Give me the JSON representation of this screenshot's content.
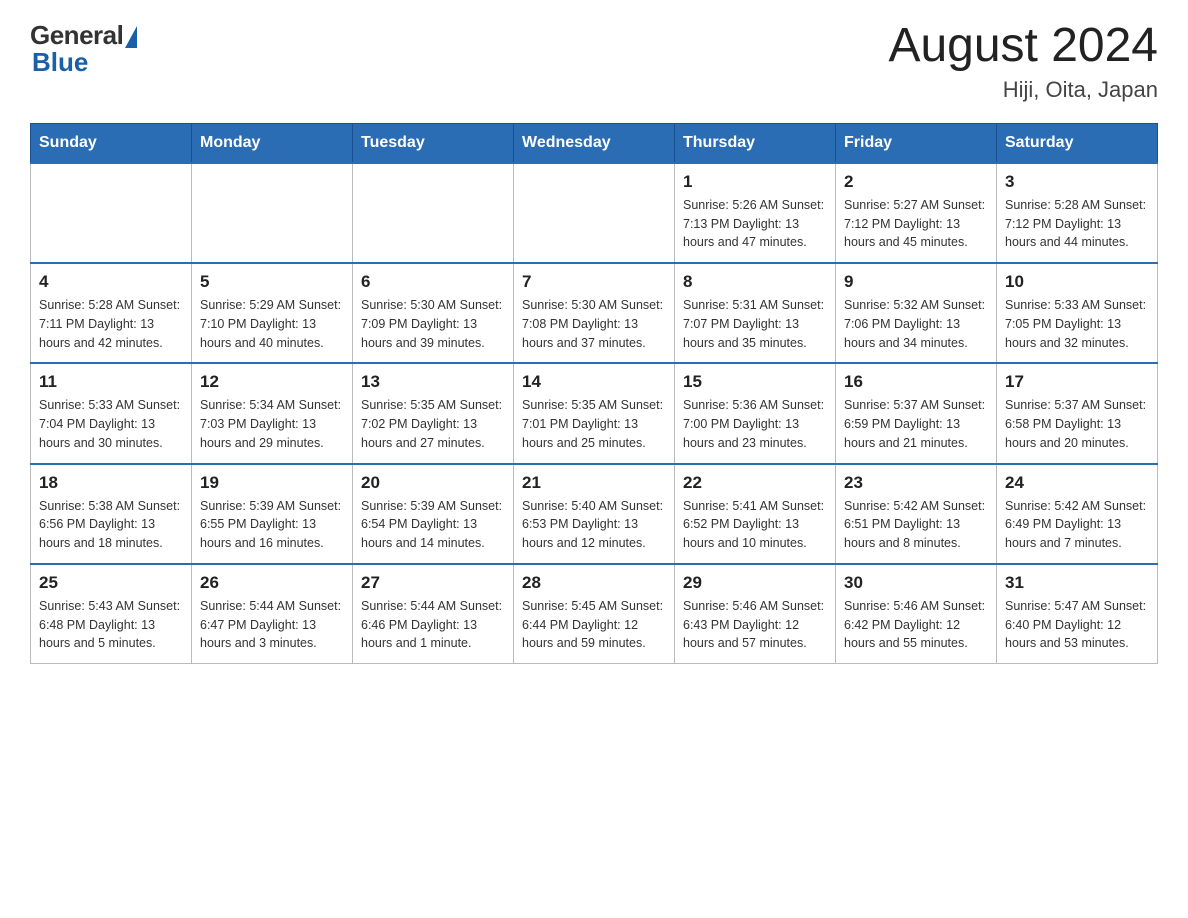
{
  "header": {
    "logo": {
      "general_text": "General",
      "blue_text": "Blue"
    },
    "title": "August 2024",
    "location": "Hiji, Oita, Japan"
  },
  "calendar": {
    "days_of_week": [
      "Sunday",
      "Monday",
      "Tuesday",
      "Wednesday",
      "Thursday",
      "Friday",
      "Saturday"
    ],
    "weeks": [
      [
        {
          "day": "",
          "info": ""
        },
        {
          "day": "",
          "info": ""
        },
        {
          "day": "",
          "info": ""
        },
        {
          "day": "",
          "info": ""
        },
        {
          "day": "1",
          "info": "Sunrise: 5:26 AM\nSunset: 7:13 PM\nDaylight: 13 hours\nand 47 minutes."
        },
        {
          "day": "2",
          "info": "Sunrise: 5:27 AM\nSunset: 7:12 PM\nDaylight: 13 hours\nand 45 minutes."
        },
        {
          "day": "3",
          "info": "Sunrise: 5:28 AM\nSunset: 7:12 PM\nDaylight: 13 hours\nand 44 minutes."
        }
      ],
      [
        {
          "day": "4",
          "info": "Sunrise: 5:28 AM\nSunset: 7:11 PM\nDaylight: 13 hours\nand 42 minutes."
        },
        {
          "day": "5",
          "info": "Sunrise: 5:29 AM\nSunset: 7:10 PM\nDaylight: 13 hours\nand 40 minutes."
        },
        {
          "day": "6",
          "info": "Sunrise: 5:30 AM\nSunset: 7:09 PM\nDaylight: 13 hours\nand 39 minutes."
        },
        {
          "day": "7",
          "info": "Sunrise: 5:30 AM\nSunset: 7:08 PM\nDaylight: 13 hours\nand 37 minutes."
        },
        {
          "day": "8",
          "info": "Sunrise: 5:31 AM\nSunset: 7:07 PM\nDaylight: 13 hours\nand 35 minutes."
        },
        {
          "day": "9",
          "info": "Sunrise: 5:32 AM\nSunset: 7:06 PM\nDaylight: 13 hours\nand 34 minutes."
        },
        {
          "day": "10",
          "info": "Sunrise: 5:33 AM\nSunset: 7:05 PM\nDaylight: 13 hours\nand 32 minutes."
        }
      ],
      [
        {
          "day": "11",
          "info": "Sunrise: 5:33 AM\nSunset: 7:04 PM\nDaylight: 13 hours\nand 30 minutes."
        },
        {
          "day": "12",
          "info": "Sunrise: 5:34 AM\nSunset: 7:03 PM\nDaylight: 13 hours\nand 29 minutes."
        },
        {
          "day": "13",
          "info": "Sunrise: 5:35 AM\nSunset: 7:02 PM\nDaylight: 13 hours\nand 27 minutes."
        },
        {
          "day": "14",
          "info": "Sunrise: 5:35 AM\nSunset: 7:01 PM\nDaylight: 13 hours\nand 25 minutes."
        },
        {
          "day": "15",
          "info": "Sunrise: 5:36 AM\nSunset: 7:00 PM\nDaylight: 13 hours\nand 23 minutes."
        },
        {
          "day": "16",
          "info": "Sunrise: 5:37 AM\nSunset: 6:59 PM\nDaylight: 13 hours\nand 21 minutes."
        },
        {
          "day": "17",
          "info": "Sunrise: 5:37 AM\nSunset: 6:58 PM\nDaylight: 13 hours\nand 20 minutes."
        }
      ],
      [
        {
          "day": "18",
          "info": "Sunrise: 5:38 AM\nSunset: 6:56 PM\nDaylight: 13 hours\nand 18 minutes."
        },
        {
          "day": "19",
          "info": "Sunrise: 5:39 AM\nSunset: 6:55 PM\nDaylight: 13 hours\nand 16 minutes."
        },
        {
          "day": "20",
          "info": "Sunrise: 5:39 AM\nSunset: 6:54 PM\nDaylight: 13 hours\nand 14 minutes."
        },
        {
          "day": "21",
          "info": "Sunrise: 5:40 AM\nSunset: 6:53 PM\nDaylight: 13 hours\nand 12 minutes."
        },
        {
          "day": "22",
          "info": "Sunrise: 5:41 AM\nSunset: 6:52 PM\nDaylight: 13 hours\nand 10 minutes."
        },
        {
          "day": "23",
          "info": "Sunrise: 5:42 AM\nSunset: 6:51 PM\nDaylight: 13 hours\nand 8 minutes."
        },
        {
          "day": "24",
          "info": "Sunrise: 5:42 AM\nSunset: 6:49 PM\nDaylight: 13 hours\nand 7 minutes."
        }
      ],
      [
        {
          "day": "25",
          "info": "Sunrise: 5:43 AM\nSunset: 6:48 PM\nDaylight: 13 hours\nand 5 minutes."
        },
        {
          "day": "26",
          "info": "Sunrise: 5:44 AM\nSunset: 6:47 PM\nDaylight: 13 hours\nand 3 minutes."
        },
        {
          "day": "27",
          "info": "Sunrise: 5:44 AM\nSunset: 6:46 PM\nDaylight: 13 hours\nand 1 minute."
        },
        {
          "day": "28",
          "info": "Sunrise: 5:45 AM\nSunset: 6:44 PM\nDaylight: 12 hours\nand 59 minutes."
        },
        {
          "day": "29",
          "info": "Sunrise: 5:46 AM\nSunset: 6:43 PM\nDaylight: 12 hours\nand 57 minutes."
        },
        {
          "day": "30",
          "info": "Sunrise: 5:46 AM\nSunset: 6:42 PM\nDaylight: 12 hours\nand 55 minutes."
        },
        {
          "day": "31",
          "info": "Sunrise: 5:47 AM\nSunset: 6:40 PM\nDaylight: 12 hours\nand 53 minutes."
        }
      ]
    ]
  }
}
